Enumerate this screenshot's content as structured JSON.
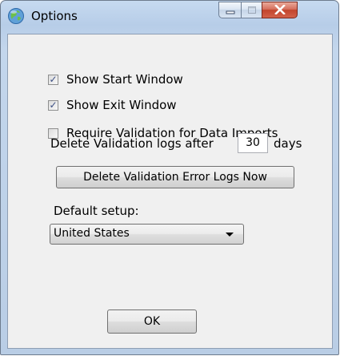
{
  "window": {
    "title": "Options",
    "title_icon": "globe-icon"
  },
  "caption": {
    "minimize_icon": "minimize-icon",
    "maximize_icon": "maximize-icon",
    "close_icon": "close-icon"
  },
  "options": {
    "show_start": {
      "label": "Show Start Window",
      "checked": true
    },
    "show_exit": {
      "label": "Show Exit Window",
      "checked": true
    },
    "require_validation": {
      "label": "Require Validation for Data Imports",
      "checked": false
    }
  },
  "validation_logs": {
    "prefix": "Delete Validation logs after",
    "days_value": "30",
    "suffix": "days",
    "delete_button": "Delete Validation Error Logs Now"
  },
  "default_setup": {
    "label": "Default setup:",
    "selected": "United States"
  },
  "footer": {
    "ok_label": "OK"
  },
  "colors": {
    "frame": "#b9cde5",
    "client": "#f0f0f0",
    "close": "#c2452d",
    "check": "#3c4f84"
  }
}
